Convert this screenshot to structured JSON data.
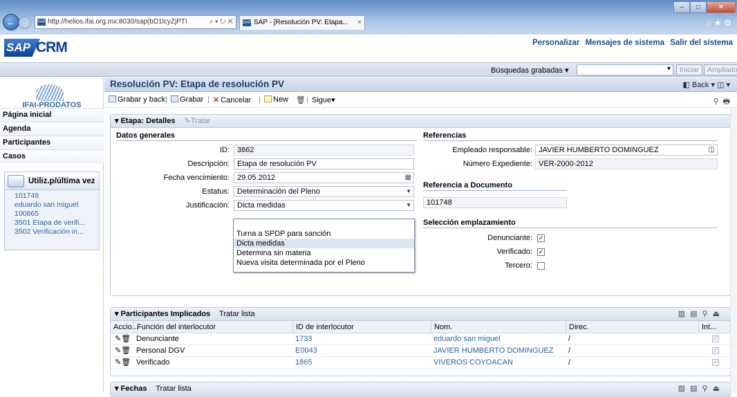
{
  "browser": {
    "address": "http://helios.ifai.org.mx:8030/sap(bD1lcyZjPTI",
    "address_host": "ifai.org.mx",
    "address_tools": "⌕ ▾ ↻ ✕",
    "tab_title": "SAP - [Resolución PV: Etapa...",
    "tab_close": "×",
    "favicon_text": "SAP",
    "min": "–",
    "max": "□",
    "close": "✕",
    "right_icons": "⌂★⚙"
  },
  "sap": {
    "logo_left": "SAP",
    "logo_right": "CRM",
    "links": [
      "Personalizar",
      "Mensajes de sistema",
      "Salir del sistema"
    ]
  },
  "search": {
    "saved_label": "Búsquedas grabadas ▾",
    "box_arrow": "▾",
    "buttons": [
      "Iniciar",
      "Ampliado"
    ]
  },
  "nav": {
    "org_name": "IFAI-PRODATOS",
    "items": [
      "Página inicial",
      "Agenda",
      "Participantes",
      "Casos"
    ],
    "recent_title": "Utiliz.p/última vez",
    "recent": [
      "101748",
      "eduardo san miguel",
      "100865",
      "3501 Etapa de verifi...",
      "3502 Verificación in..."
    ]
  },
  "page": {
    "title": "Resolución PV: Etapa de resolución PV",
    "back": "◧ Back ▾ ◫ ▾"
  },
  "toolbar": {
    "save_back": "Grabar y back",
    "save": "Grabar",
    "cancel": "Cancelar",
    "new": "New",
    "more": "Sigue",
    "more_arrow": "▾",
    "right_icons": "⚲🖶"
  },
  "details": {
    "head": "▾ Etapa: Detalles",
    "edit": "Tratar",
    "general_title": "Datos generales",
    "fields": {
      "id_label": "ID:",
      "id_value": "3862",
      "desc_label": "Descripción:",
      "desc_value": "Etapa de resolución PV",
      "due_label": "Fecha vencimiento:",
      "due_value": "29.05.2012",
      "status_label": "Estatus:",
      "status_value": "Determinación del Pleno",
      "just_label": "Justificación:",
      "just_value": "Dicta medidas"
    },
    "dropdown_options": [
      "",
      "Turna a SPDP para sanción",
      "Dicta medidas",
      "Determina sin materia",
      "Nueva visita determinada por el Pleno"
    ],
    "refs_title": "Referencias",
    "emp_label": "Empleado responsable:",
    "emp_value": "JAVIER HUMBERTO DOMINGUEZ",
    "exp_label": "Número Expediente:",
    "exp_value": "VER-2000-2012",
    "doc_title": "Referencia a Documento",
    "doc_value": "101748",
    "loc_title": "Selección emplazamiento",
    "loc": [
      {
        "label": "Denunciante:",
        "checked": "✓"
      },
      {
        "label": "Verificado:",
        "checked": "✓"
      },
      {
        "label": "Tercero:",
        "checked": ""
      }
    ]
  },
  "participants": {
    "head": "▾ Participantes Implicados",
    "edit_list": "Tratar lista",
    "head_icons": "▥▤⚲⏏",
    "columns": [
      "Accio...",
      "Función del interlocutor",
      "ID de interlocutor",
      "Nom.",
      "Direc.",
      "Int..."
    ],
    "rows": [
      {
        "actions": "✎🗑",
        "role": "Denunciante",
        "id": "1733",
        "name": "eduardo san miguel",
        "addr": "/",
        "int": "✓"
      },
      {
        "actions": "✎🗑",
        "role": "Personal DGV",
        "id": "E0043",
        "name": "JAVIER HUMBERTO DOMINGUEZ",
        "addr": "/",
        "int": "✓"
      },
      {
        "actions": "✎🗑",
        "role": "Verificado",
        "id": "1865",
        "name": "VIVEROS COYOACAN",
        "addr": "/",
        "int": "✓"
      }
    ]
  },
  "dates": {
    "head": "▾ Fechas",
    "edit_list": "Tratar lista",
    "head_icons": "▥▤⚲⏏"
  }
}
